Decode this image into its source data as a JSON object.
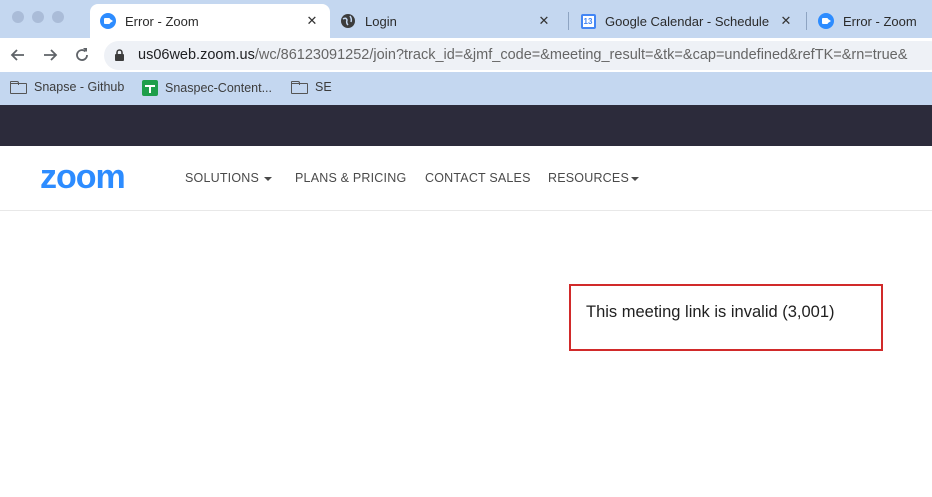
{
  "browser": {
    "tabs": [
      {
        "title": "Error - Zoom",
        "favicon": "zoom-icon",
        "active": true
      },
      {
        "title": "Login",
        "favicon": "globe-icon",
        "active": false
      },
      {
        "title": "Google Calendar - Schedule st",
        "favicon": "google-calendar-icon",
        "favicon_text": "13",
        "active": false
      },
      {
        "title": "Error - Zoom",
        "favicon": "zoom-icon",
        "active": false
      }
    ],
    "close_glyph": "✕",
    "url_host": "us06web.zoom.us",
    "url_path": "/wc/86123091252/join?track_id=&jmf_code=&meeting_result=&tk=&cap=undefined&refTK=&rn=true&",
    "bookmarks": [
      {
        "label": "Snapse - Github",
        "icon": "folder-icon"
      },
      {
        "label": "Snaspec-Content...",
        "icon": "google-sheets-icon"
      },
      {
        "label": "SE",
        "icon": "folder-icon"
      }
    ],
    "colors": {
      "chrome_bg": "#c4d7f0",
      "active_tab": "#ffffff"
    }
  },
  "site": {
    "logo": "zoom",
    "nav": [
      {
        "label": "SOLUTIONS",
        "has_dropdown": true
      },
      {
        "label": "PLANS & PRICING",
        "has_dropdown": false
      },
      {
        "label": "CONTACT SALES",
        "has_dropdown": false
      },
      {
        "label": "RESOURCES",
        "has_dropdown": true
      }
    ],
    "colors": {
      "brand": "#2d8cff",
      "banner": "#2c2b3b"
    }
  },
  "error": {
    "message": "This meeting link is invalid (3,001)",
    "border_color": "#d12a2a"
  }
}
